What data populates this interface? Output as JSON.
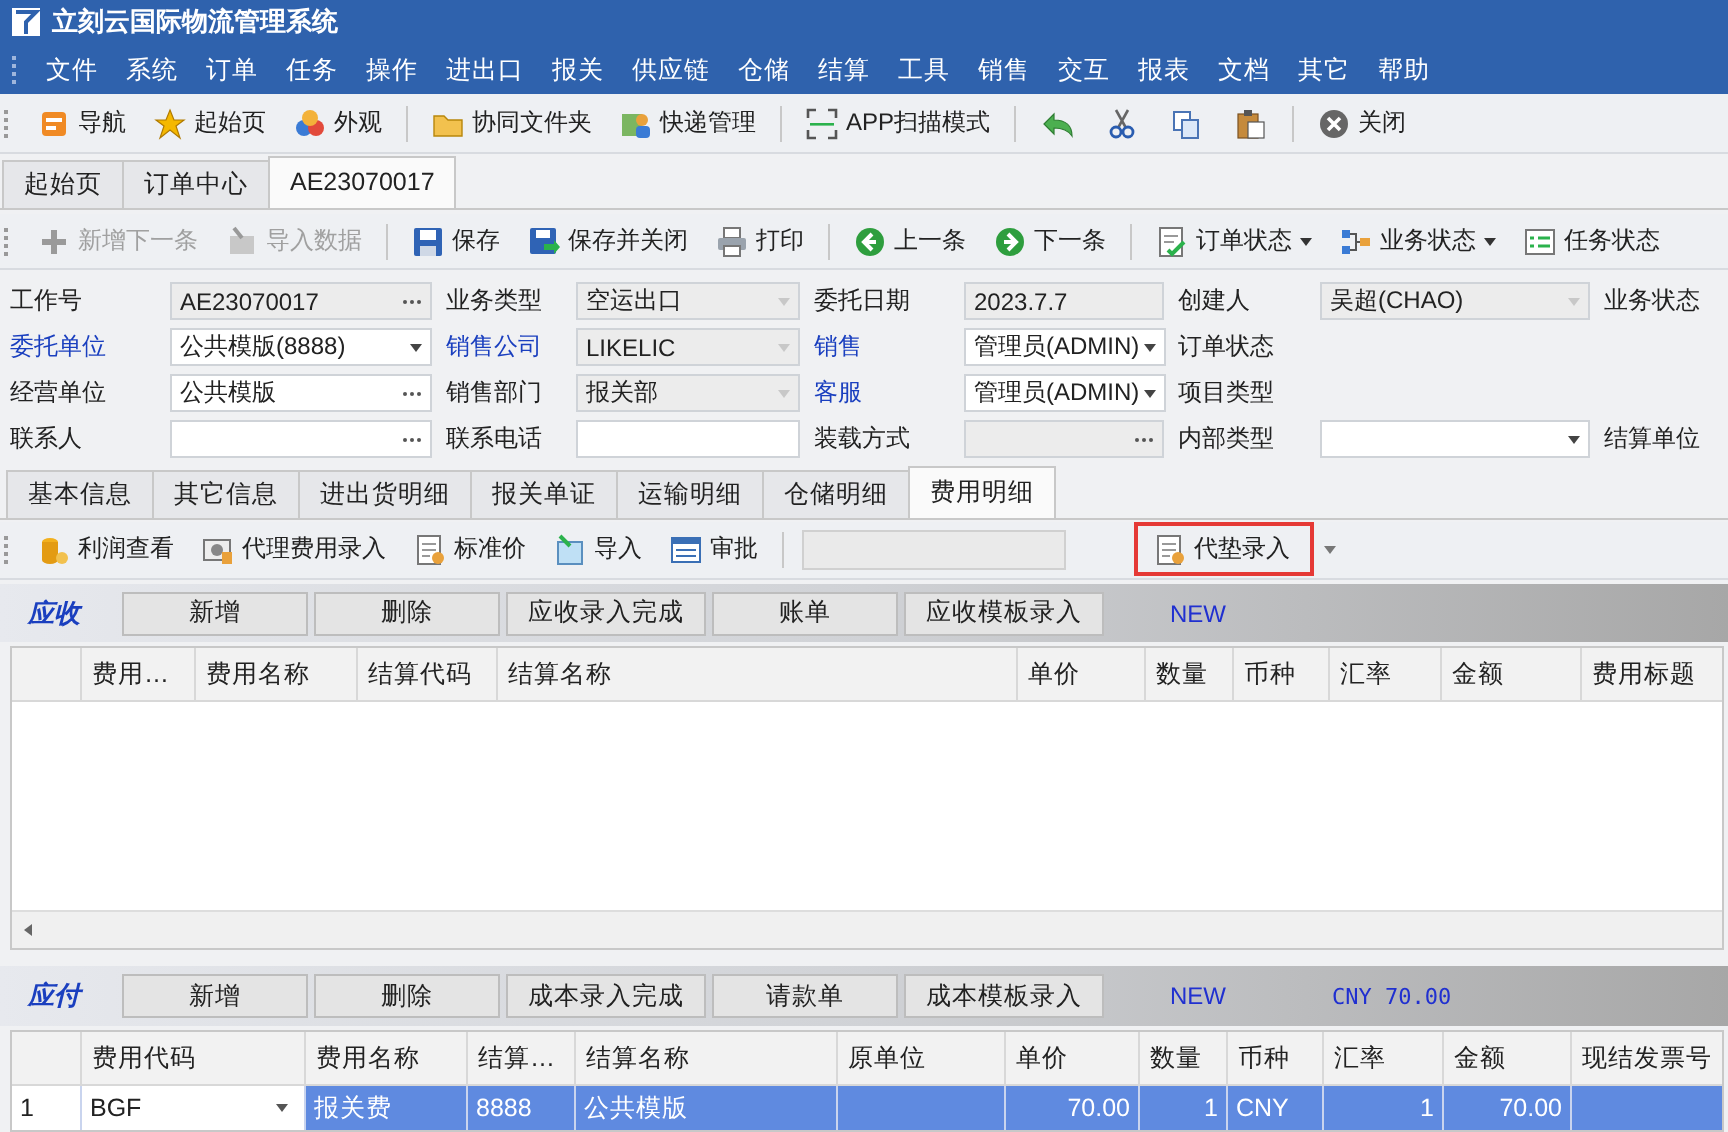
{
  "window": {
    "title": "立刻云国际物流管理系统"
  },
  "menu": [
    "文件",
    "系统",
    "订单",
    "任务",
    "操作",
    "进出口",
    "报关",
    "供应链",
    "仓储",
    "结算",
    "工具",
    "销售",
    "交互",
    "报表",
    "文档",
    "其它",
    "帮助"
  ],
  "toolbar": [
    {
      "kind": "button",
      "label": "导航"
    },
    {
      "kind": "button",
      "label": "起始页"
    },
    {
      "kind": "button",
      "label": "外观"
    },
    {
      "kind": "separator"
    },
    {
      "kind": "button",
      "label": "协同文件夹"
    },
    {
      "kind": "button",
      "label": "快递管理"
    },
    {
      "kind": "separator"
    },
    {
      "kind": "button",
      "label": "APP扫描模式"
    },
    {
      "kind": "separator"
    },
    {
      "kind": "icon"
    },
    {
      "kind": "icon"
    },
    {
      "kind": "icon"
    },
    {
      "kind": "icon"
    },
    {
      "kind": "separator"
    },
    {
      "kind": "button",
      "label": "关闭"
    }
  ],
  "doc_tabs": [
    {
      "label": "起始页",
      "selected": false
    },
    {
      "label": "订单中心",
      "selected": false
    },
    {
      "label": "AE23070017",
      "selected": true
    }
  ],
  "actions": [
    {
      "kind": "button",
      "label": "新增下一条",
      "disabled": true
    },
    {
      "kind": "button",
      "label": "导入数据",
      "disabled": true
    },
    {
      "kind": "separator"
    },
    {
      "kind": "button",
      "label": "保存",
      "disabled": false
    },
    {
      "kind": "button",
      "label": "保存并关闭",
      "disabled": false
    },
    {
      "kind": "button",
      "label": "打印",
      "disabled": false
    },
    {
      "kind": "separator"
    },
    {
      "kind": "button",
      "label": "上一条",
      "disabled": false
    },
    {
      "kind": "button",
      "label": "下一条",
      "disabled": false
    },
    {
      "kind": "separator"
    },
    {
      "kind": "button",
      "label": "订单状态",
      "disabled": false,
      "has_menu": true
    },
    {
      "kind": "button",
      "label": "业务状态",
      "disabled": false,
      "has_menu": true
    },
    {
      "kind": "button",
      "label": "任务状态",
      "disabled": false
    }
  ],
  "form": [
    [
      {
        "label": "工作号",
        "link": false,
        "value": "AE23070017",
        "kind": "ellipsis",
        "disabled": true
      },
      {
        "label": "业务类型",
        "link": false,
        "value": "空运出口",
        "kind": "dropdown",
        "disabled": true
      },
      {
        "label": "委托日期",
        "link": false,
        "value": "2023.7.7",
        "kind": "text",
        "disabled": true
      },
      {
        "label": "创建人",
        "link": false,
        "value": "吴超(CHAO)",
        "kind": "dropdown",
        "disabled": true
      },
      {
        "label": "业务状态",
        "link": false
      }
    ],
    [
      {
        "label": "委托单位",
        "link": true,
        "value": "公共模版(8888)",
        "kind": "dropdown",
        "disabled": false
      },
      {
        "label": "销售公司",
        "link": true,
        "value": "LIKELIC",
        "kind": "dropdown",
        "disabled": true
      },
      {
        "label": "销售",
        "link": true,
        "value": "管理员(ADMIN)",
        "kind": "dropdown",
        "disabled": false
      },
      {
        "label": "订单状态",
        "link": false
      }
    ],
    [
      {
        "label": "经营单位",
        "link": false,
        "value": "公共模版",
        "kind": "ellipsis",
        "disabled": false
      },
      {
        "label": "销售部门",
        "link": false,
        "value": "报关部",
        "kind": "dropdown",
        "disabled": true
      },
      {
        "label": "客服",
        "link": true,
        "value": "管理员(ADMIN)",
        "kind": "dropdown",
        "disabled": false
      },
      {
        "label": "项目类型",
        "link": false
      }
    ],
    [
      {
        "label": "联系人",
        "link": false,
        "kind": "ellipsis",
        "disabled": false
      },
      {
        "label": "联系电话",
        "link": false,
        "kind": "text",
        "disabled": false
      },
      {
        "label": "装载方式",
        "link": false,
        "kind": "ellipsis",
        "disabled": true
      },
      {
        "label": "内部类型",
        "link": false,
        "kind": "dropdown",
        "disabled": false
      },
      {
        "label": "结算单位",
        "link": false
      }
    ]
  ],
  "section_tabs": [
    {
      "label": "基本信息",
      "selected": false
    },
    {
      "label": "其它信息",
      "selected": false
    },
    {
      "label": "进出货明细",
      "selected": false
    },
    {
      "label": "报关单证",
      "selected": false
    },
    {
      "label": "运输明细",
      "selected": false
    },
    {
      "label": "仓储明细",
      "selected": false
    },
    {
      "label": "费用明细",
      "selected": true
    }
  ],
  "fee_toolbar": [
    {
      "kind": "button",
      "label": "利润查看",
      "highlighted": false
    },
    {
      "kind": "button",
      "label": "代理费用录入",
      "highlighted": false
    },
    {
      "kind": "button",
      "label": "标准价",
      "highlighted": false
    },
    {
      "kind": "button",
      "label": "导入",
      "highlighted": false
    },
    {
      "kind": "button",
      "label": "审批",
      "highlighted": false
    },
    {
      "kind": "separator"
    },
    {
      "kind": "field"
    },
    {
      "kind": "button",
      "label": "代垫录入",
      "highlighted": true
    },
    {
      "kind": "menu"
    }
  ],
  "receivable": {
    "title": "应收",
    "buttons": [
      "新增",
      "删除",
      "应收录入完成",
      "账单",
      "应收模板录入"
    ],
    "new_label": "NEW",
    "columns": [
      "费用…",
      "费用名称",
      "结算代码",
      "结算名称",
      "单价",
      "数量",
      "币种",
      "汇率",
      "金额",
      "费用标题"
    ]
  },
  "payable": {
    "title": "应付",
    "buttons": [
      "新增",
      "删除",
      "成本录入完成",
      "请款单",
      "成本模板录入"
    ],
    "new_label": "NEW",
    "total": "CNY 70.00",
    "columns": [
      "费用代码",
      "费用名称",
      "结算…",
      "结算名称",
      "原单位",
      "单价",
      "数量",
      "币种",
      "汇率",
      "金额",
      "现结发票号"
    ],
    "rows": [
      {
        "selected": true,
        "number": "1",
        "cells": [
          "BGF",
          "报关费",
          "8888",
          "公共模版",
          null,
          "70.00",
          "1",
          "CNY",
          "1",
          "70.00",
          null
        ]
      }
    ]
  }
}
